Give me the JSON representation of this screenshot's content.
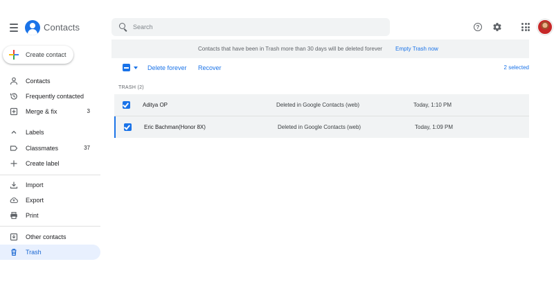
{
  "header": {
    "app_title": "Contacts",
    "search_placeholder": "Search"
  },
  "sidebar": {
    "create_label": "Create contact",
    "items": [
      {
        "label": "Contacts",
        "count": ""
      },
      {
        "label": "Frequently contacted",
        "count": ""
      },
      {
        "label": "Merge & fix",
        "count": "3"
      },
      {
        "label": "Labels",
        "count": ""
      },
      {
        "label": "Classmates",
        "count": "37"
      },
      {
        "label": "Create label",
        "count": ""
      },
      {
        "label": "Import",
        "count": ""
      },
      {
        "label": "Export",
        "count": ""
      },
      {
        "label": "Print",
        "count": ""
      },
      {
        "label": "Other contacts",
        "count": ""
      },
      {
        "label": "Trash",
        "count": ""
      }
    ]
  },
  "banner": {
    "message": "Contacts that have been in Trash more than 30 days will be deleted forever",
    "action": "Empty Trash now"
  },
  "toolbar": {
    "delete_forever": "Delete forever",
    "recover": "Recover",
    "selected": "2 selected"
  },
  "trash": {
    "header": "TRASH (2)",
    "rows": [
      {
        "name": "Aditya OP",
        "status": "Deleted in Google Contacts (web)",
        "time": "Today, 1:10 PM"
      },
      {
        "name": "Eric Bachman(Honor 8X)",
        "status": "Deleted in Google Contacts (web)",
        "time": "Today, 1:09 PM"
      }
    ]
  },
  "colors": {
    "accent": "#1a73e8",
    "active_nav_bg": "#e8f0fe",
    "row_bg": "#f1f3f4"
  }
}
